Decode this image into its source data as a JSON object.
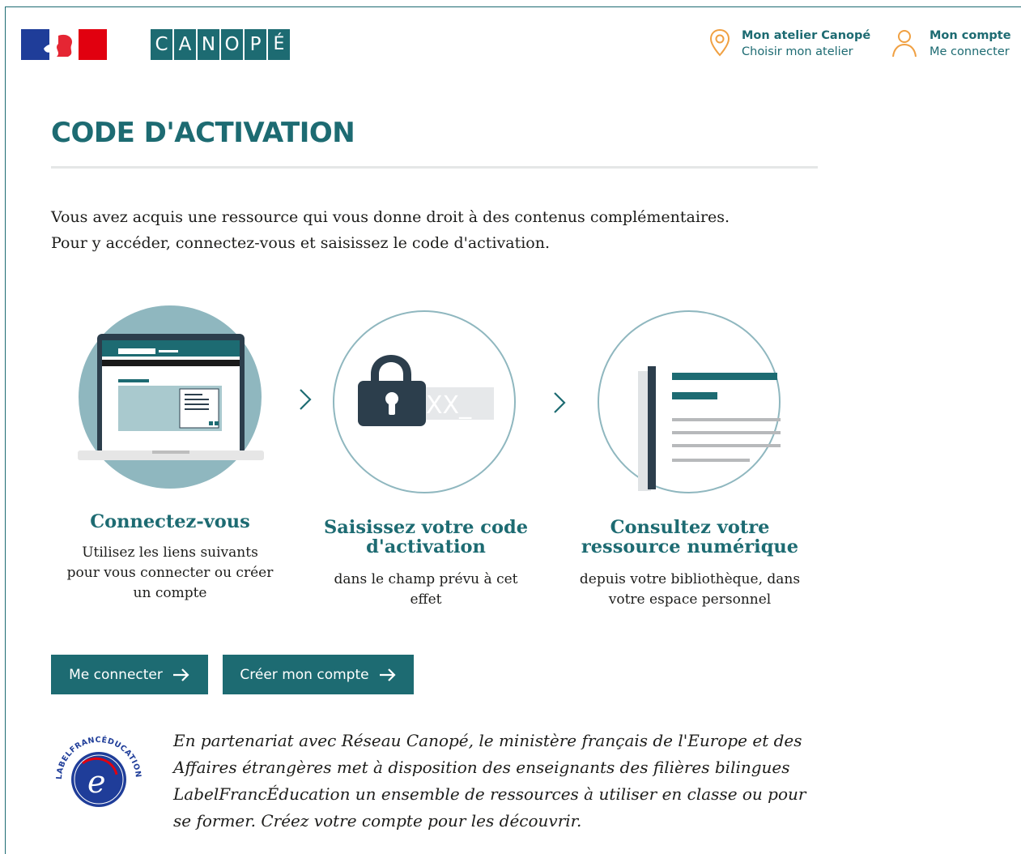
{
  "header": {
    "logo_gov_alt": "République française",
    "logo_brand_letters": [
      "C",
      "A",
      "N",
      "O",
      "P",
      "É"
    ],
    "atelier": {
      "title": "Mon atelier Canopé",
      "subtitle": "Choisir mon atelier",
      "icon": "map-pin-icon"
    },
    "account": {
      "title": "Mon compte",
      "subtitle": "Me connecter",
      "icon": "user-icon"
    }
  },
  "page": {
    "title": "CODE D'ACTIVATION",
    "intro_line1": "Vous avez acquis une ressource qui vous donne droit à des contenus complémentaires.",
    "intro_line2": "Pour y accéder, connectez-vous et saisissez le code d'activation."
  },
  "steps": [
    {
      "title": "Connectez-vous",
      "desc": "Utilisez les liens suivants pour vous connecter ou créer un compte",
      "icon": "laptop-illustration"
    },
    {
      "title": "Saisissez votre code d'activation",
      "desc": "dans le champ prévu à cet effet",
      "icon": "padlock-code-illustration",
      "code_placeholder": "XX_"
    },
    {
      "title": "Consultez votre ressource numérique",
      "desc": "depuis votre bibliothèque, dans votre espace personnel",
      "icon": "document-illustration"
    }
  ],
  "buttons": {
    "connect": "Me connecter",
    "create": "Créer mon compte"
  },
  "partner": {
    "logo_text": "LABELFRANCÉDUCATION",
    "text": "En partenariat avec Réseau Canopé, le ministère français de l'Europe et des Affaires étrangères met à disposition des enseignants des filières bilingues LabelFrancÉducation un ensemble de ressources à utiliser en classe ou pour se former. Créez votre compte pour les découvrir."
  },
  "colors": {
    "brand": "#1d6b72",
    "accent_orange": "#f0a042",
    "illustration_light": "#8fb7bf",
    "illustration_dark": "#2c3e4c"
  }
}
